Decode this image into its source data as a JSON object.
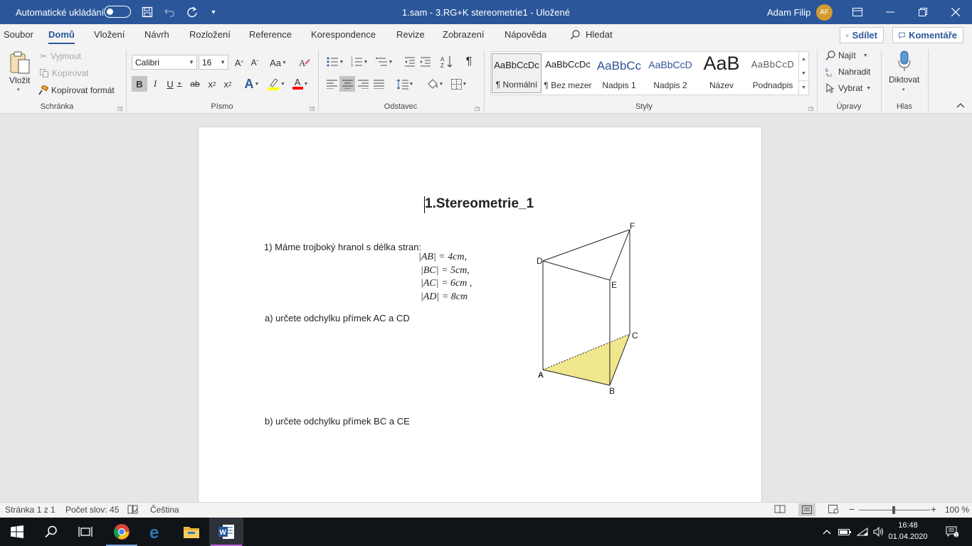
{
  "titlebar": {
    "autosave_label": "Automatické ukládání",
    "doc_title": "1.sam - 3.RG+K stereometrie1  -  Uložené",
    "user_name": "Adam Filip",
    "user_initials": "AF",
    "icons": [
      "save-icon",
      "undo-icon",
      "redo-icon",
      "customize-qat-icon",
      "ribbon-display-icon",
      "minimize-icon",
      "restore-icon",
      "close-icon"
    ]
  },
  "menu": {
    "tabs": [
      "Soubor",
      "Domů",
      "Vložení",
      "Návrh",
      "Rozložení",
      "Reference",
      "Korespondence",
      "Revize",
      "Zobrazení",
      "Nápověda"
    ],
    "search_label": "Hledat",
    "share_label": "Sdílet",
    "comments_label": "Komentáře"
  },
  "ribbon": {
    "clipboard": {
      "paste_label": "Vložit",
      "cut_label": "Vyjmout",
      "copy_label": "Kopírovat",
      "format_painter_label": "Kopírovat formát",
      "group_label": "Schránka"
    },
    "font": {
      "font_name": "Calibri",
      "font_size": "16",
      "grow_label": "A",
      "shrink_label": "A",
      "case_label": "Aa",
      "bold_label": "B",
      "italic_label": "I",
      "underline_label": "U",
      "strike_label": "ab",
      "sub_label": "x",
      "sub_mark": "2",
      "sup_label": "x",
      "sup_mark": "2",
      "effects_label": "A",
      "highlight_color": "#ffff00",
      "font_color_label": "A",
      "font_color": "#ff0000",
      "group_label": "Písmo"
    },
    "paragraph": {
      "group_label": "Odstavec"
    },
    "styles": {
      "items": [
        {
          "sample": "AaBbCcDc",
          "name": "¶ Normální"
        },
        {
          "sample": "AaBbCcDc",
          "name": "¶ Bez mezer"
        },
        {
          "sample": "AaBbCc",
          "name": "Nadpis 1"
        },
        {
          "sample": "AaBbCcD",
          "name": "Nadpis 2"
        },
        {
          "sample": "AaB",
          "name": "Název"
        },
        {
          "sample": "AaBbCcD",
          "name": "Podnadpis"
        }
      ],
      "group_label": "Styly"
    },
    "editing": {
      "find_label": "Najít",
      "replace_label": "Nahradit",
      "select_label": "Vybrat",
      "group_label": "Úpravy"
    },
    "voice": {
      "dictate_label": "Diktovat",
      "group_label": "Hlas"
    }
  },
  "document": {
    "heading": "1.Stereometrie_1",
    "problem_intro": "1) Máme trojboký hranol s délka stran:",
    "equations": [
      "|AB| = 4cm,",
      "|BC| = 5cm,",
      "|AC| = 6cm ,",
      "|AD| = 8cm"
    ],
    "task_a": "a) určete odchylku přímek AC a CD",
    "task_b": "b) určete odchylku přímek BC a CE",
    "figure_labels": {
      "A": "A",
      "B": "B",
      "C": "C",
      "D": "D",
      "E": "E",
      "F": "F"
    },
    "base_fill_color": "#f0e68c"
  },
  "statusbar": {
    "page": "Stránka 1 z 1",
    "words": "Počet slov: 45",
    "language": "Čeština",
    "zoom": "100 %"
  },
  "taskbar": {
    "time": "16:48",
    "date": "01.04.2020",
    "apps": [
      "chrome-icon",
      "edge-icon",
      "file-explorer-icon",
      "word-icon"
    ]
  }
}
